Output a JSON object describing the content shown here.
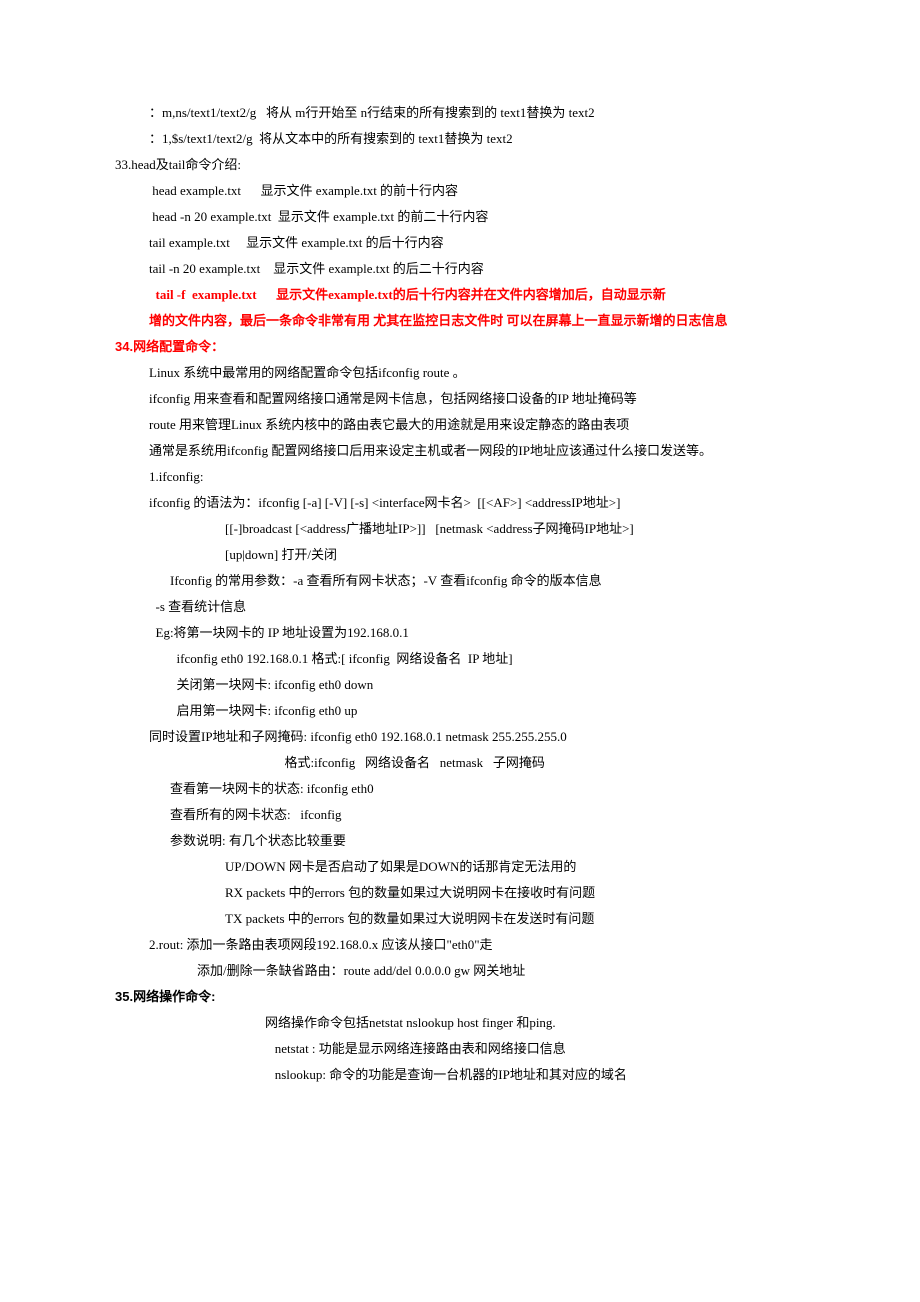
{
  "lines": [
    {
      "cls": "indent1",
      "txt": "：m,ns/text1/text2/g   将从 m行开始至 n行结束的所有搜索到的 text1替换为 text2"
    },
    {
      "cls": "indent1",
      "txt": "：1,$s/text1/text2/g  将从文本中的所有搜索到的 text1替换为 text2"
    },
    {
      "cls": "",
      "txt": "33.head及tail命令介绍:"
    },
    {
      "cls": "indent1",
      "txt": " head example.txt      显示文件 example.txt 的前十行内容"
    },
    {
      "cls": "indent1",
      "txt": " head -n 20 example.txt  显示文件 example.txt 的前二十行内容"
    },
    {
      "cls": "indent1",
      "txt": "tail example.txt     显示文件 example.txt 的后十行内容"
    },
    {
      "cls": "indent1",
      "txt": "tail -n 20 example.txt    显示文件 example.txt 的后二十行内容"
    },
    {
      "cls": "indent1 red bold",
      "txt": "  tail -f  example.txt      显示文件example.txt的后十行内容并在文件内容增加后，自动显示新"
    },
    {
      "cls": "indent1 red bold",
      "txt": "增的文件内容，最后一条命令非常有用 尤其在监控日志文件时 可以在屏幕上一直显示新增的日志信息"
    },
    {
      "cls": "red bold sans",
      "txt": "34.网络配置命令："
    },
    {
      "cls": "indent1",
      "txt": "Linux 系统中最常用的网络配置命令包括ifconfig route 。"
    },
    {
      "cls": "indent1",
      "txt": "ifconfig 用来查看和配置网络接口通常是网卡信息，包括网络接口设备的IP 地址掩码等"
    },
    {
      "cls": "indent1",
      "txt": "route 用来管理Linux 系统内核中的路由表它最大的用途就是用来设定静态的路由表项"
    },
    {
      "cls": "indent1",
      "txt": "通常是系统用ifconfig 配置网络接口后用来设定主机或者一网段的IP地址应该通过什么接口发送等。"
    },
    {
      "cls": "indent1",
      "txt": "1.ifconfig:"
    },
    {
      "cls": "indent1",
      "txt": "ifconfig 的语法为：ifconfig [-a] [-V] [-s] <interface网卡名>  [[<AF>] <addressIP地址>]"
    },
    {
      "cls": "indent4",
      "txt": "[[-]broadcast [<address广播地址IP>]]   [netmask <address子网掩码IP地址>]"
    },
    {
      "cls": "indent4",
      "txt": "[up|down] 打开/关闭"
    },
    {
      "cls": "indent2",
      "txt": "Ifconfig 的常用参数：-a 查看所有网卡状态；-V 查看ifconfig 命令的版本信息"
    },
    {
      "cls": "indent1",
      "txt": "  -s 查看统计信息"
    },
    {
      "cls": "indent1",
      "txt": "  Eg:将第一块网卡的 IP 地址设置为192.168.0.1"
    },
    {
      "cls": "indent2",
      "txt": "  ifconfig eth0 192.168.0.1 格式:[ ifconfig  网络设备名  IP 地址]"
    },
    {
      "cls": "indent2",
      "txt": "  关闭第一块网卡: ifconfig eth0 down"
    },
    {
      "cls": "indent2",
      "txt": "  启用第一块网卡: ifconfig eth0 up"
    },
    {
      "cls": "indent1",
      "txt": "同时设置IP地址和子网掩码: ifconfig eth0 192.168.0.1 netmask 255.255.255.0"
    },
    {
      "cls": "indent5",
      "txt": "      格式:ifconfig   网络设备名   netmask   子网掩码"
    },
    {
      "cls": "indent2",
      "txt": "查看第一块网卡的状态: ifconfig eth0"
    },
    {
      "cls": "indent2",
      "txt": "查看所有的网卡状态:   ifconfig"
    },
    {
      "cls": "indent2",
      "txt": "参数说明: 有几个状态比较重要"
    },
    {
      "cls": "indent4",
      "txt": "UP/DOWN 网卡是否启动了如果是DOWN的话那肯定无法用的"
    },
    {
      "cls": "indent4",
      "txt": "RX packets 中的errors 包的数量如果过大说明网卡在接收时有问题"
    },
    {
      "cls": "indent4",
      "txt": "TX packets 中的errors 包的数量如果过大说明网卡在发送时有问题"
    },
    {
      "cls": "indent1",
      "txt": "2.rout: 添加一条路由表项网段192.168.0.x 应该从接口\"eth0\"走"
    },
    {
      "cls": "indent3",
      "txt": "添加/删除一条缺省路由：route add/del 0.0.0.0 gw 网关地址"
    },
    {
      "cls": "bold sans",
      "txt": "35.网络操作命令:"
    },
    {
      "cls": "indent5",
      "txt": "网络操作命令包括netstat nslookup host finger 和ping."
    },
    {
      "cls": "indent5",
      "txt": "   netstat : 功能是显示网络连接路由表和网络接口信息"
    },
    {
      "cls": "indent5",
      "txt": "   nslookup: 命令的功能是查询一台机器的IP地址和其对应的域名"
    }
  ]
}
